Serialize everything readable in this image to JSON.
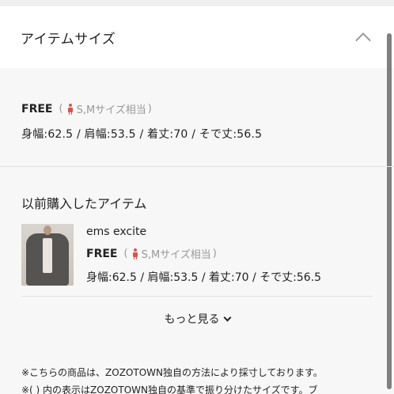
{
  "header": {
    "title": "アイテムサイズ",
    "toggle_icon": "chevron-up-icon"
  },
  "size_info": {
    "size": "FREE",
    "paren_open": "(",
    "equivalent": "S,Mサイズ相当",
    "paren_close": ")",
    "measurements": "身幅:62.5 / 肩幅:53.5 / 着丈:70 / そで丈:56.5"
  },
  "previous": {
    "title": "以前購入したアイテム",
    "item": {
      "name": "ems excite",
      "size": "FREE",
      "paren_open": "(",
      "equivalent": "S,Mサイズ相当",
      "paren_close": ")",
      "measurements": "身幅:62.5 / 肩幅:53.5 / 着丈:70 / そで丈:56.5"
    },
    "more_label": "もっと見る"
  },
  "notes": [
    "※こちらの商品は、ZOZOTOWN独自の方法により採寸しております。",
    "※( ) 内の表示はZOZOTOWN独自の基準で振り分けたサイズです。ブ"
  ],
  "colors": {
    "accent_icon": "#d9534f",
    "muted_text": "#999999"
  }
}
